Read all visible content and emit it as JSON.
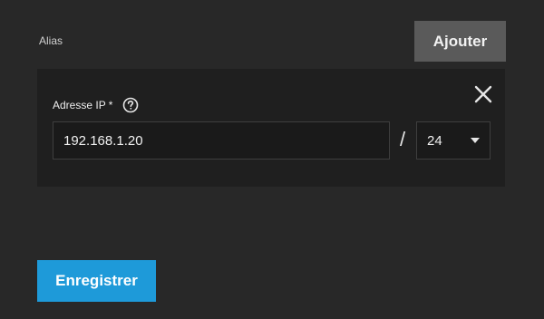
{
  "aliases": {
    "label": "Alias",
    "add_label": "Ajouter",
    "close_icon": "close-icon",
    "ip_field": {
      "label": "Adresse IP",
      "required_marker": "*",
      "help_icon": "help-circle-icon",
      "value": "192.168.1.20"
    },
    "separator": "/",
    "netmask": {
      "value": "24",
      "dropdown_icon": "caret-down-icon"
    }
  },
  "footer": {
    "save_label": "Enregistrer"
  },
  "colors": {
    "background": "#282828",
    "card": "#1f1f1f",
    "add_button": "#5a5a5a",
    "save_button": "#1e9ad9"
  }
}
